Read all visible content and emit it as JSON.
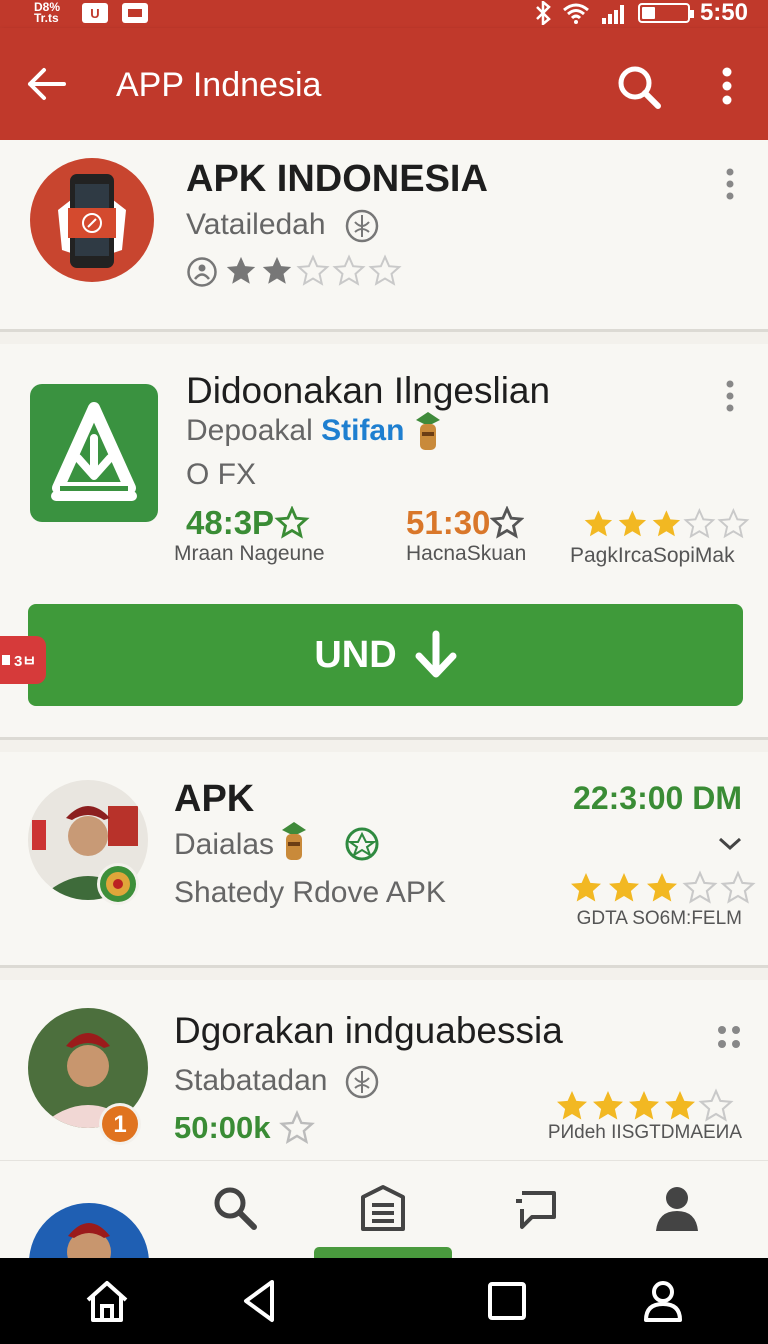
{
  "status_bar": {
    "left_text": "D8%\nTr.ts",
    "box1": "U",
    "box2": "",
    "time": "5:50",
    "battery_level": 0.3
  },
  "app_bar": {
    "title": "APP Indnesia",
    "icons": [
      "back-arrow-icon",
      "search-icon",
      "more-vert-icon"
    ]
  },
  "apps": [
    {
      "name": "APK INDONESIA",
      "subtitle": "Vatailedah",
      "rating": 2,
      "icon": "phone-icon"
    },
    {
      "name": "Didoonakan Ilngeslian",
      "developer_prefix": "Depoakal",
      "developer_link": "Stifan",
      "size": "O FX",
      "stats": [
        {
          "value": "48:3P",
          "label": "Mraan Nageune",
          "color": "#3a8c35"
        },
        {
          "value": "51:30",
          "label": "HacnaSkuan",
          "color": "#d9772a"
        },
        {
          "value": "",
          "label": "PagkIrcaSopiMak",
          "rating": 3
        }
      ],
      "install_label": "UND",
      "side_badge": "3ㅂ",
      "icon": "download-app-icon"
    },
    {
      "name": "APK",
      "subtitle": "Daialas",
      "description": "Shatedy Rdove APK",
      "time": "22:3:00 DM",
      "rating": 3,
      "caption": "GDTA SO6M:FELM",
      "icon": "avatar"
    },
    {
      "name": "Dgorakan indguabessia",
      "subtitle": "Stabatadan",
      "count": "50:00k",
      "rating": 4,
      "caption": "PИdeh IISGTDMAEИA",
      "badge": "1",
      "icon": "avatar"
    }
  ],
  "bottom_nav": [
    "search-icon",
    "news-icon",
    "chat-icon",
    "profile-icon"
  ],
  "system_nav": [
    "home-icon",
    "back-triangle-icon",
    "recents-icon",
    "user-icon"
  ],
  "colors": {
    "primary": "#c0392b",
    "accent_green": "#3f9a3a",
    "link_blue": "#1e7fd0",
    "star_gold": "#f2b822"
  }
}
